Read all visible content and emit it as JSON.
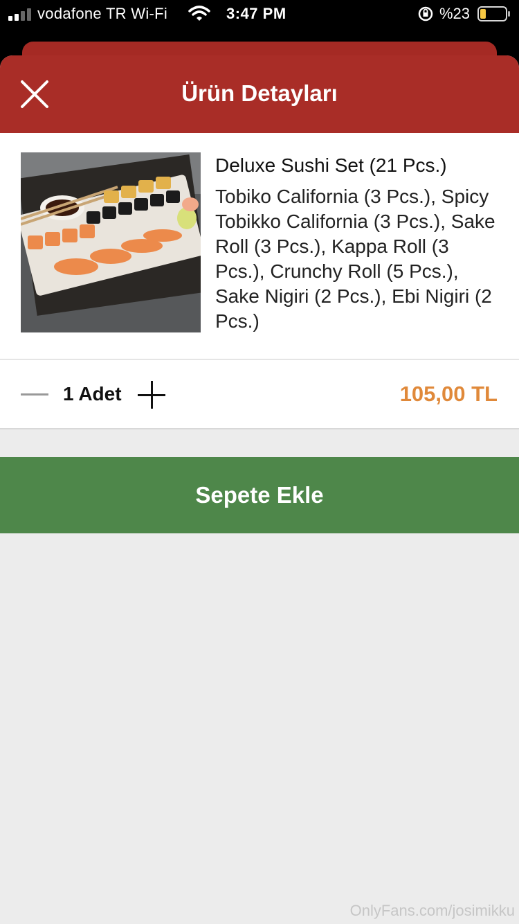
{
  "status_bar": {
    "carrier": "vodafone TR Wi-Fi",
    "time": "3:47 PM",
    "battery": "%23",
    "icons": [
      "signal-icon",
      "wifi-icon",
      "orientation-lock-icon",
      "battery-icon"
    ]
  },
  "header": {
    "title": "Ürün Detayları",
    "close_icon": "close-icon",
    "color": "#a92d27"
  },
  "product": {
    "name": "Deluxe Sushi Set (21 Pcs.)",
    "description": "Tobiko California (3 Pcs.), Spicy Tobikko California (3 Pcs.), Sake Roll (3 Pcs.), Kappa Roll (3 Pcs.), Crunchy Roll (5 Pcs.), Sake Nigiri (2 Pcs.), Ebi Nigiri (2 Pcs.)"
  },
  "quantity": {
    "label": "1 Adet",
    "price": "105,00 TL",
    "price_color": "#e0893a"
  },
  "actions": {
    "add_to_cart": "Sepete Ekle",
    "color": "#4e874a"
  },
  "watermark": "OnlyFans.com/josimikku"
}
